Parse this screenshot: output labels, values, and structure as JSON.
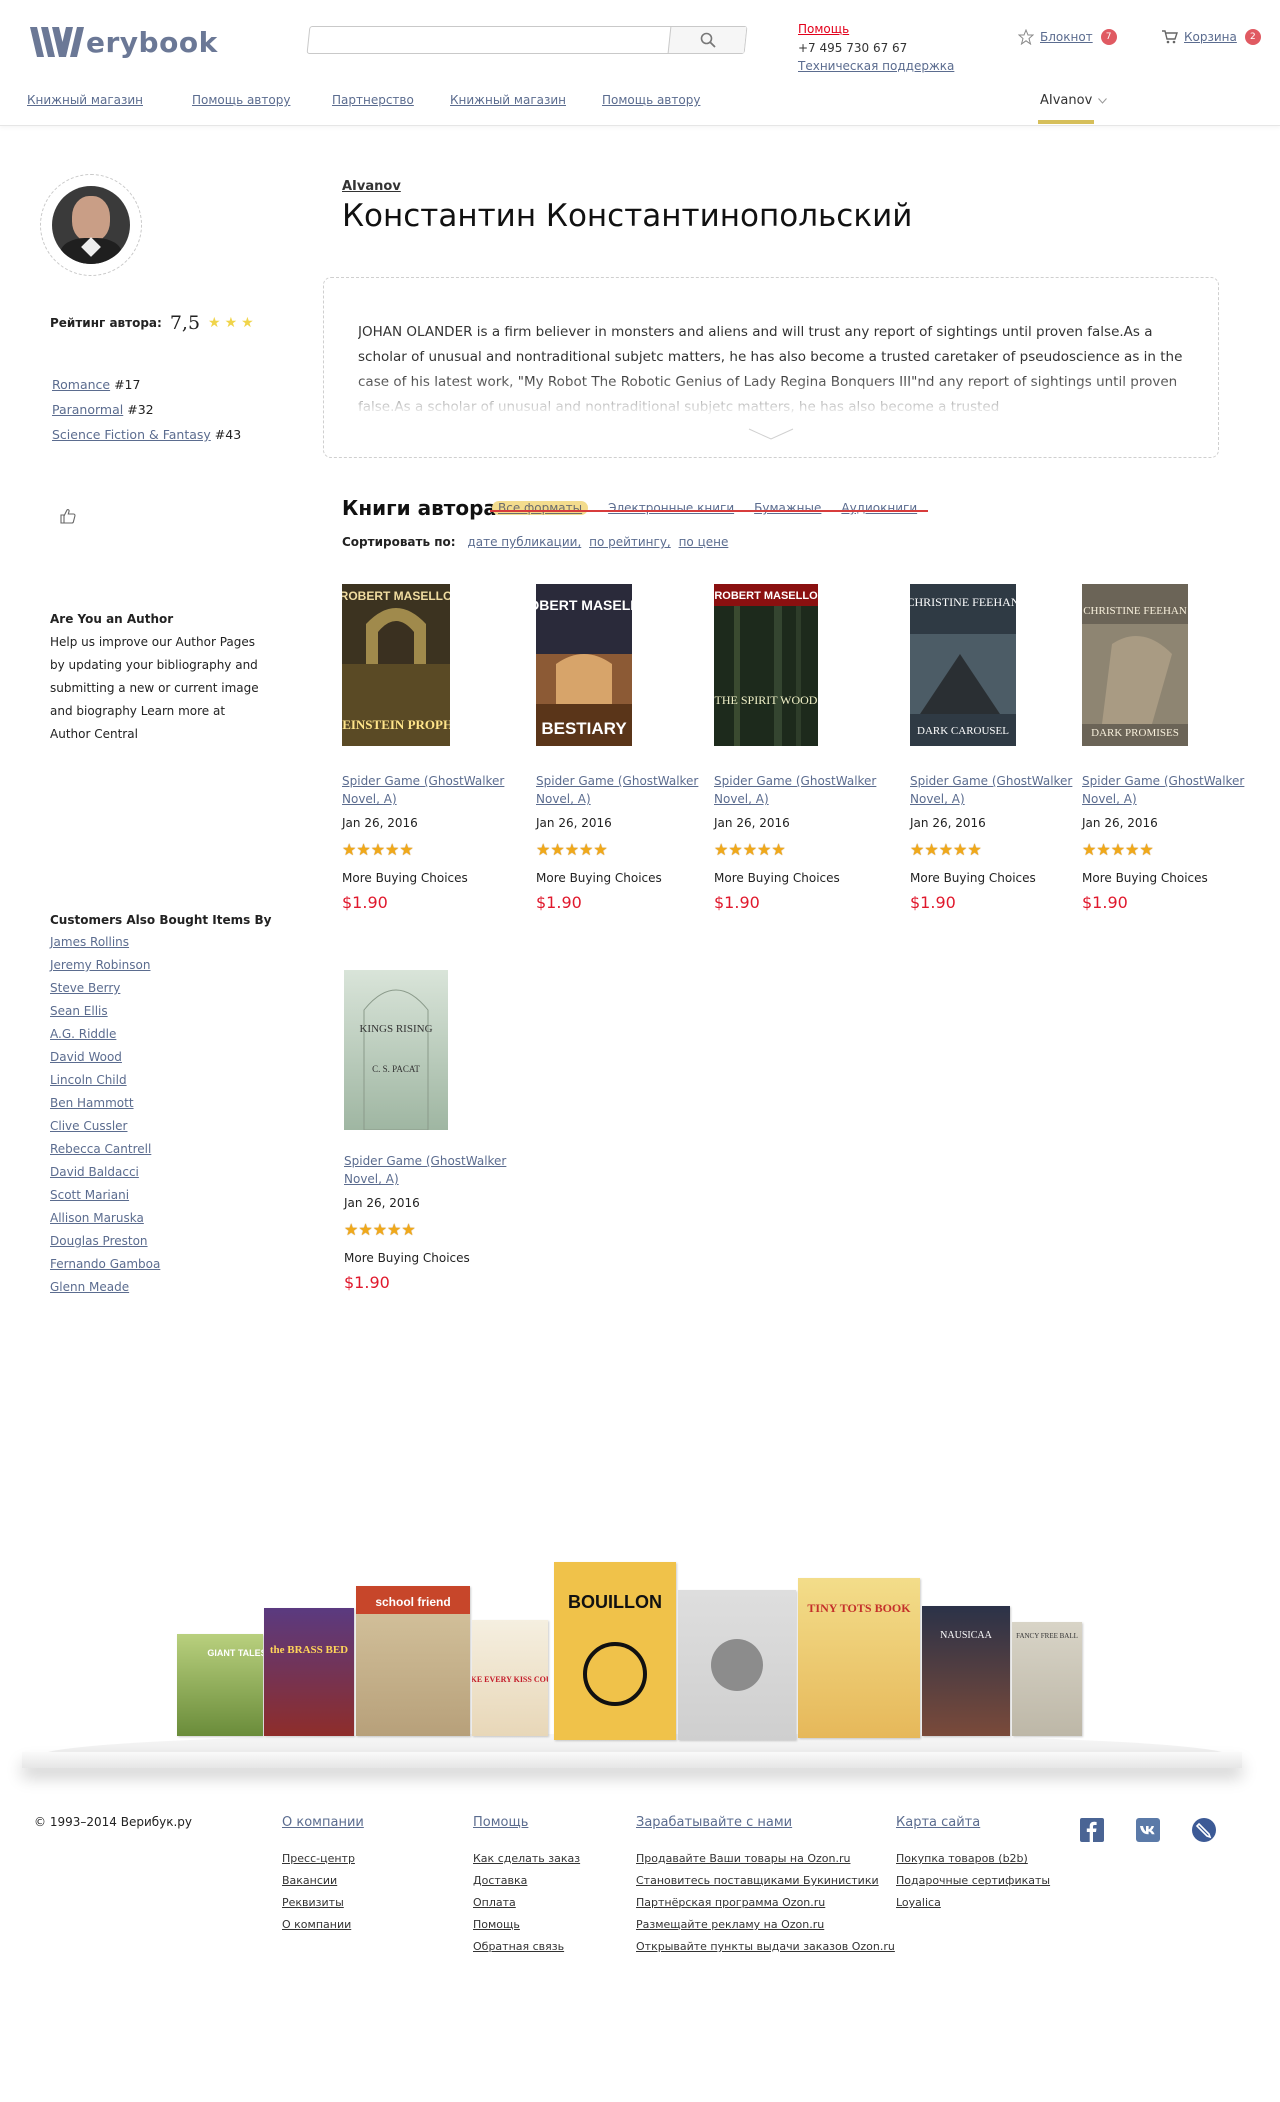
{
  "header": {
    "logo_text": "erybook",
    "search_placeholder": "",
    "help_label": "Помощь",
    "phone": "+7 495 730 67 67",
    "support_label": "Техническая поддержка",
    "notepad_label": "Блокнот",
    "notepad_count": "7",
    "cart_label": "Корзина",
    "cart_count": "2"
  },
  "nav": {
    "items": [
      "Книжный магазин",
      "Помощь автору",
      "Партнерство",
      "Книжный магазин",
      "Помощь автору"
    ],
    "user": "AIvanov"
  },
  "author": {
    "tag": "AIvanov",
    "name": "Константин Константинопольский",
    "rating_label": "Рейтинг автора:",
    "rating_value": "7,5",
    "rating_stars": "★★★",
    "genres": [
      {
        "name": "Romance",
        "rank": "#17"
      },
      {
        "name": "Paranormal",
        "rank": "#32"
      },
      {
        "name": "Science Fiction & Fantasy",
        "rank": "#43"
      }
    ],
    "bio": "JOHAN OLANDER is a firm believer in monsters and aliens and will trust any report of sightings until proven false.As a scholar of unusual and nontraditional subjetc matters, he has also become a trusted caretaker of pseudoscience as in the case of his latest work, \"My Robot The Robotic Genius of Lady Regina Bonquers III\"nd any report of sightings until proven false.As a scholar of unusual and nontraditional subjetc matters, he has also become a trusted"
  },
  "author_box": {
    "title": "Are You an Author",
    "text": "Help us improve our Author Pages by updating your bibliography and submitting a new or current image and biography Learn more at Author Central"
  },
  "also_bought": {
    "title": "Customers Also Bought Items By",
    "authors": [
      "James Rollins",
      "Jeremy Robinson",
      "Steve Berry",
      "Sean Ellis",
      "A.G. Riddle",
      "David Wood",
      "Lincoln Child",
      "Ben Hammott",
      "Clive Cussler",
      "Rebecca Cantrell",
      "David Baldacci",
      "Scott Mariani",
      "Allison Maruska",
      "Douglas Preston",
      "Fernando Gamboa",
      "Glenn Meade"
    ]
  },
  "books_section": {
    "title": "Книги автора",
    "filters": [
      "Все форматы",
      "Электронные книги",
      "Бумажные",
      "Аудиокниги"
    ],
    "sort_label": "Сортировать по:",
    "sort_options": [
      "дате публикации,",
      "по рейтингу,",
      "по цене"
    ]
  },
  "books": [
    {
      "cover_author": "ROBERT MASELLO",
      "cover_title": "THE EINSTEIN PROPHECY",
      "title": "Spider Game (GhostWalker Novel, A)",
      "date": "Jan 26, 2016",
      "rating": 4.5,
      "stars": "★★★★★",
      "more": "More Buying Choices",
      "price": "$1.90"
    },
    {
      "cover_author": "ROBERT MASELLO",
      "cover_title": "BESTIARY",
      "title": "Spider Game (GhostWalker Novel, A)",
      "date": "Jan 26, 2016",
      "rating": 4.5,
      "stars": "★★★★★",
      "more": "More Buying Choices",
      "price": "$1.90"
    },
    {
      "cover_author": "ROBERT MASELLO",
      "cover_title": "THE SPIRIT WOOD",
      "title": "Spider Game (GhostWalker Novel, A)",
      "date": "Jan 26, 2016",
      "rating": 4.5,
      "stars": "★★★★★",
      "more": "More Buying Choices",
      "price": "$1.90"
    },
    {
      "cover_author": "CHRISTINE FEEHAN",
      "cover_title": "DARK CAROUSEL",
      "title": "Spider Game (GhostWalker Novel, A)",
      "date": "Jan 26, 2016",
      "rating": 4.5,
      "stars": "★★★★★",
      "more": "More Buying Choices",
      "price": "$1.90"
    },
    {
      "cover_author": "CHRISTINE FEEHAN",
      "cover_title": "DARK PROMISES",
      "title": "Spider Game (GhostWalker Novel, A)",
      "date": "Jan 26, 2016",
      "rating": 4.5,
      "stars": "★★★★★",
      "more": "More Buying Choices",
      "price": "$1.90"
    },
    {
      "cover_author": "C. S. PACAT",
      "cover_title": "KINGS RISING",
      "title": "Spider Game (GhostWalker Novel, A)",
      "date": "Jan 26, 2016",
      "rating": 4.5,
      "stars": "★★★★★",
      "more": "More Buying Choices",
      "price": "$1.90"
    }
  ],
  "shelf": {
    "titles": [
      "GIANT TALES",
      "the BRASS BED",
      "school friend",
      "MAKE EVERY KISS COUNT",
      "BOUILLON",
      "",
      "TINY TOTS BOOK",
      "NAUSICAA",
      "FANCY FREE BALL"
    ]
  },
  "footer": {
    "copyright": "© 1993–2014 Верибук.ру",
    "columns": [
      {
        "title": "О компании",
        "links": [
          "Пресс-центр",
          "Вакансии",
          "Реквизиты",
          "О компании"
        ]
      },
      {
        "title": "Помощь",
        "links": [
          "Как сделать заказ",
          "Доставка",
          "Оплата",
          "Помощь",
          "Обратная связь"
        ]
      },
      {
        "title": "Зарабатывайте с нами",
        "links": [
          "Продавайте Ваши товары на Ozon.ru",
          "Становитесь поставщиками Букинистики",
          "Партнёрская программа Ozon.ru",
          "Размещайте рекламу на Ozon.ru",
          "Открывайте пункты выдачи заказов Ozon.ru"
        ]
      },
      {
        "title": "Карта сайта",
        "links": [
          "Покупка товаров (b2b)",
          "Подарочные сертификаты",
          "Loyalica"
        ]
      }
    ],
    "social": [
      "facebook-icon",
      "vk-icon",
      "livejournal-icon"
    ]
  }
}
